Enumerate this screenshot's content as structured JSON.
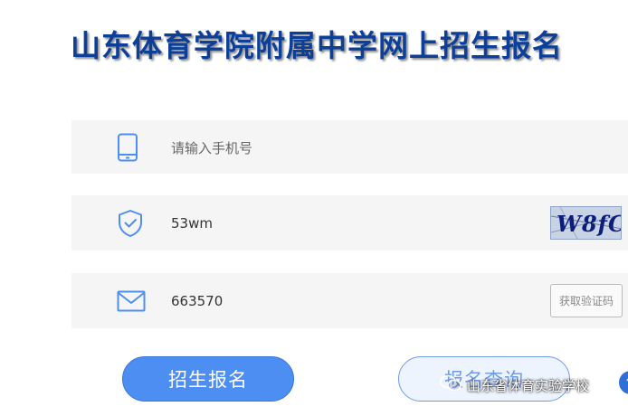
{
  "page": {
    "title": "山东体育学院附属中学网上招生报名"
  },
  "form": {
    "phone": {
      "icon": "mobile-phone-icon",
      "placeholder": "请输入手机号"
    },
    "captcha": {
      "icon": "shield-check-icon",
      "value": "53wm",
      "image_text": "W8fC"
    },
    "sms_code": {
      "icon": "envelope-icon",
      "value": "663570",
      "get_code_label": "获取验证码"
    }
  },
  "actions": {
    "register_label": "招生报名",
    "query_label": "报名查询"
  },
  "watermark": {
    "icon": "wechat-icon",
    "text": "山东省体育实验学校"
  },
  "colors": {
    "title": "#0b3f9a",
    "primary": "#4d8ef3",
    "icon": "#4d8ef3",
    "row_bg": "#f5f5f5"
  }
}
